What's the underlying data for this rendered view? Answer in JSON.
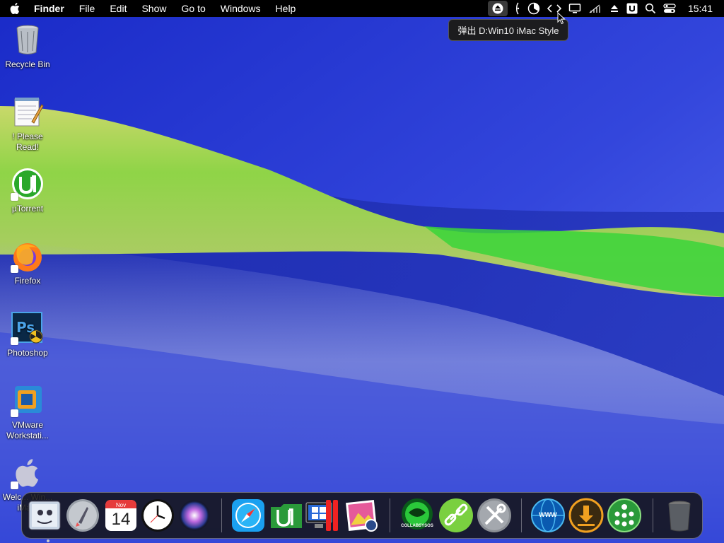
{
  "menubar": {
    "apple_icon": "apple-logo-icon",
    "app_name": "Finder",
    "menus": [
      "File",
      "Edit",
      "Show",
      "Go to",
      "Windows",
      "Help"
    ],
    "status_icons": [
      "eject-icon",
      "brightness-icon",
      "pie-chart-icon",
      "code-brackets-icon",
      "display-icon",
      "no-wifi-icon",
      "eject-small-icon",
      "u-icon",
      "search-icon",
      "control-center-icon"
    ],
    "clock": "15:41"
  },
  "tooltip": {
    "text": "弹出 D:Win10 iMac Style"
  },
  "desktop": {
    "icons": [
      {
        "label": "Recycle Bin",
        "icon": "recycle-bin-icon"
      },
      {
        "label": "! Please Read!",
        "icon": "notepad-icon"
      },
      {
        "label": "µTorrent",
        "icon": "utorrent-icon"
      },
      {
        "label": "Firefox",
        "icon": "firefox-icon"
      },
      {
        "label": "Photoshop",
        "icon": "photoshop-icon"
      },
      {
        "label": "VMware Workstati...",
        "icon": "vmware-icon"
      },
      {
        "label": "Welc... Win... iMa...",
        "icon": "apple-logo-icon"
      }
    ]
  },
  "dock": {
    "calendar": {
      "month": "Nov",
      "day": "14"
    },
    "collabsysos_label": "COLLABSYSOS",
    "www_label": "WWW",
    "items": [
      "finder-icon",
      "launchpad-icon",
      "calendar-icon",
      "clock-icon",
      "siri-icon",
      "safari-icon",
      "utorrent-icon",
      "parallels-icon",
      "photo-viewer-icon",
      "collabsysos-icon",
      "link-icon",
      "tools-icon",
      "www-globe-icon",
      "download-icon",
      "network-icon",
      "trash-icon"
    ]
  }
}
